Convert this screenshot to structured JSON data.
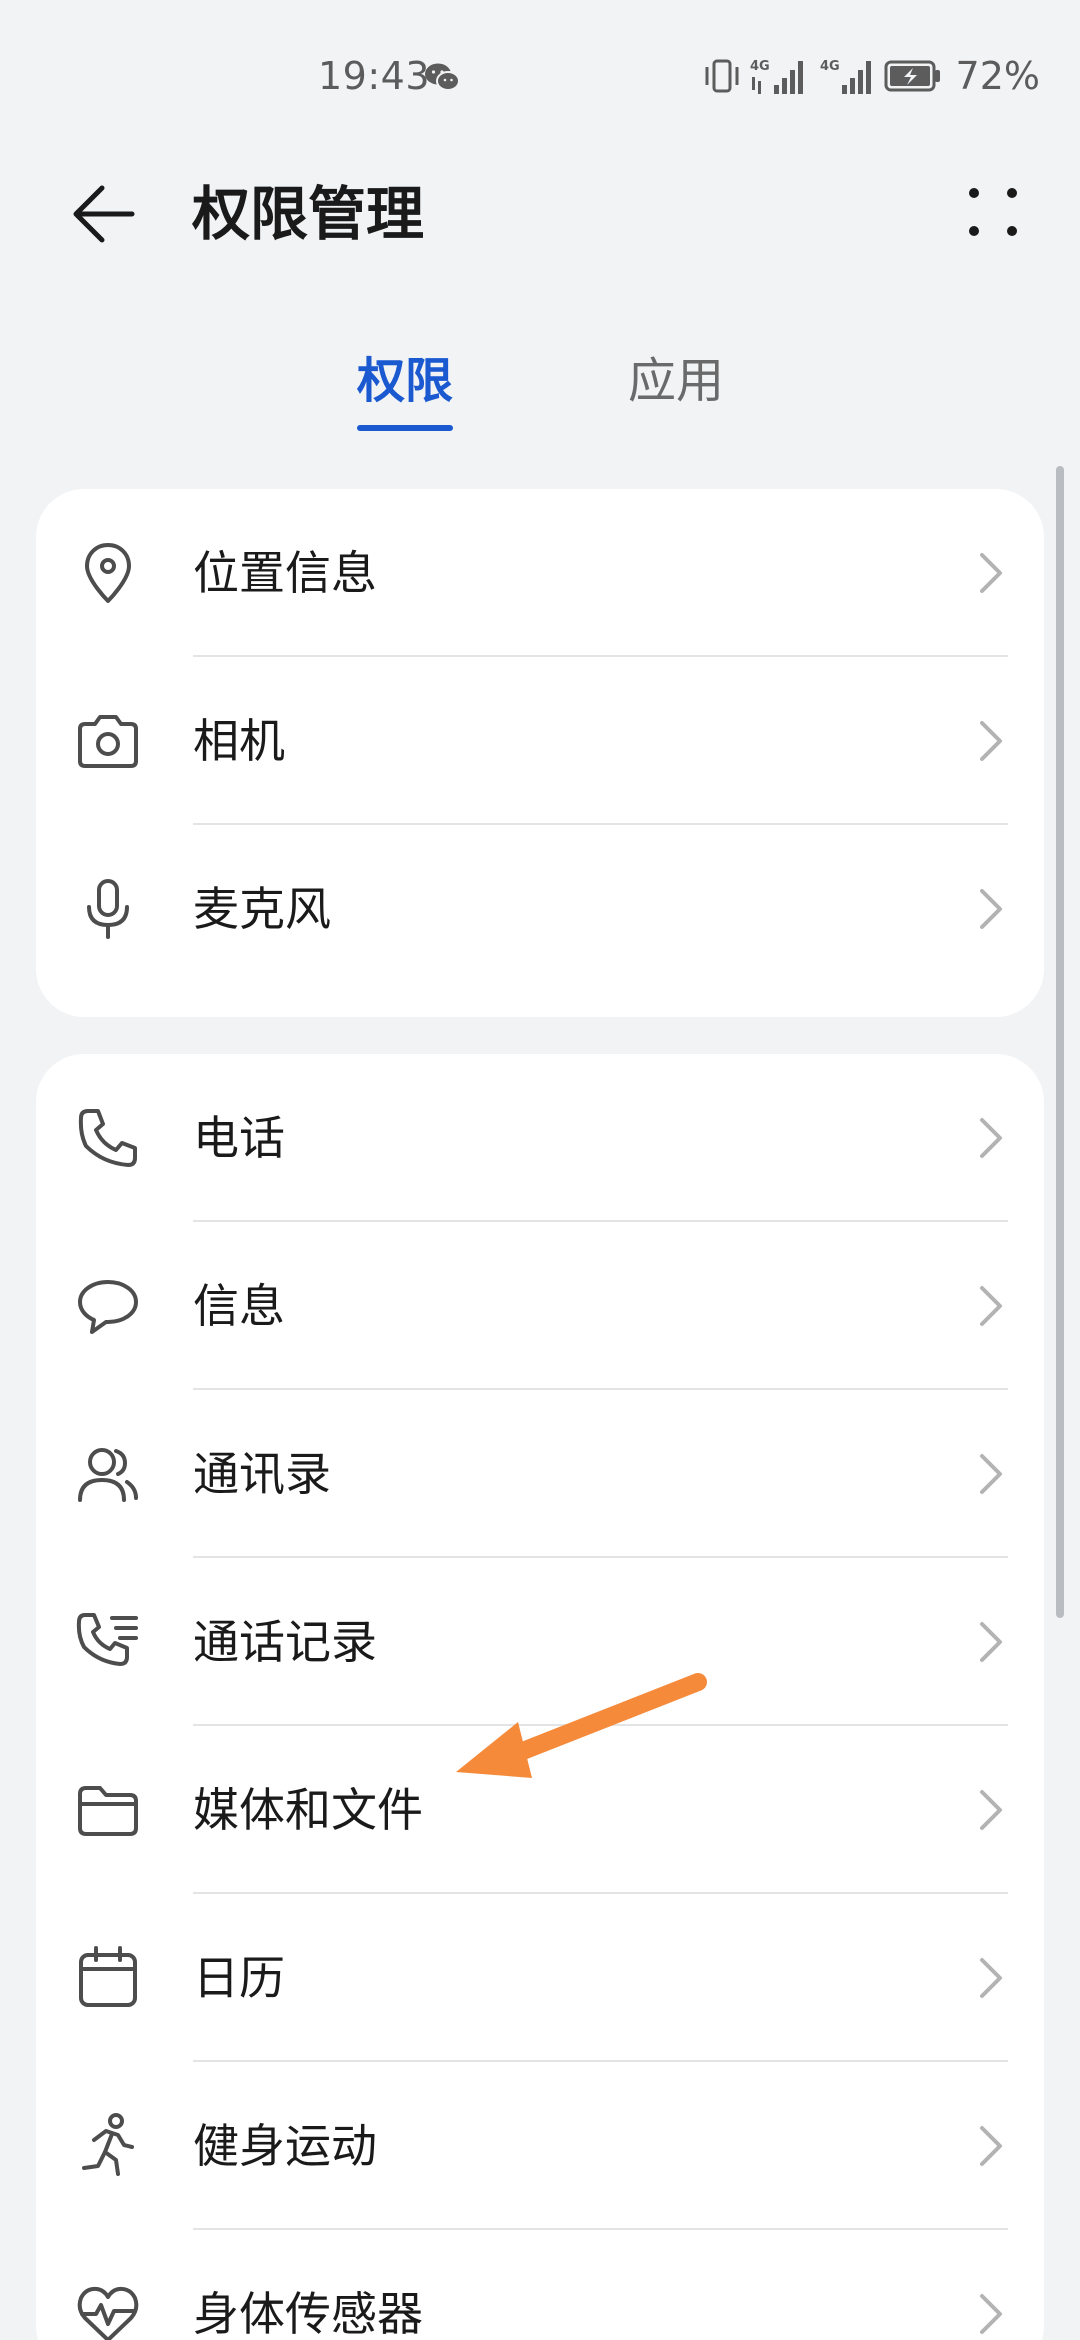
{
  "status_bar": {
    "time": "19:43",
    "battery_percent": "72%",
    "network_1": "4G",
    "network_2": "4G"
  },
  "header": {
    "title": "权限管理"
  },
  "tabs": [
    {
      "label": "权限",
      "selected": true
    },
    {
      "label": "应用",
      "selected": false
    }
  ],
  "groups": [
    {
      "items": [
        {
          "label": "位置信息",
          "icon": "location-icon"
        },
        {
          "label": "相机",
          "icon": "camera-icon"
        },
        {
          "label": "麦克风",
          "icon": "microphone-icon"
        }
      ]
    },
    {
      "items": [
        {
          "label": "电话",
          "icon": "phone-icon"
        },
        {
          "label": "信息",
          "icon": "message-icon"
        },
        {
          "label": "通讯录",
          "icon": "contacts-icon"
        },
        {
          "label": "通话记录",
          "icon": "call-log-icon"
        },
        {
          "label": "媒体和文件",
          "icon": "folder-icon"
        },
        {
          "label": "日历",
          "icon": "calendar-icon"
        },
        {
          "label": "健身运动",
          "icon": "running-icon"
        },
        {
          "label": "身体传感器",
          "icon": "heart-rate-icon"
        }
      ]
    }
  ],
  "colors": {
    "accent": "#1b59d1",
    "background": "#f1f3f5",
    "card": "#ffffff",
    "annotation_arrow": "#f58a3a"
  }
}
